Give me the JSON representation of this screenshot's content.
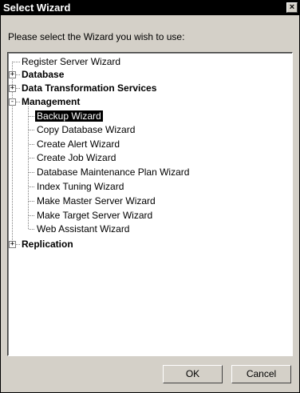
{
  "window": {
    "title": "Select Wizard",
    "close_glyph": "×"
  },
  "prompt": "Please select the Wizard you wish to use:",
  "tree": {
    "items": [
      {
        "label": "Register Server Wizard"
      },
      {
        "label": "Database",
        "toggle": "+"
      },
      {
        "label": "Data Transformation Services",
        "toggle": "+"
      },
      {
        "label": "Management",
        "toggle": "-"
      },
      {
        "label": "Backup Wizard",
        "selected": true
      },
      {
        "label": "Copy Database Wizard"
      },
      {
        "label": "Create Alert Wizard"
      },
      {
        "label": "Create Job Wizard"
      },
      {
        "label": "Database Maintenance Plan Wizard"
      },
      {
        "label": "Index Tuning Wizard"
      },
      {
        "label": "Make Master Server Wizard"
      },
      {
        "label": "Make Target Server Wizard"
      },
      {
        "label": "Web Assistant Wizard"
      },
      {
        "label": "Replication",
        "toggle": "+"
      }
    ]
  },
  "buttons": {
    "ok": "OK",
    "cancel": "Cancel"
  }
}
